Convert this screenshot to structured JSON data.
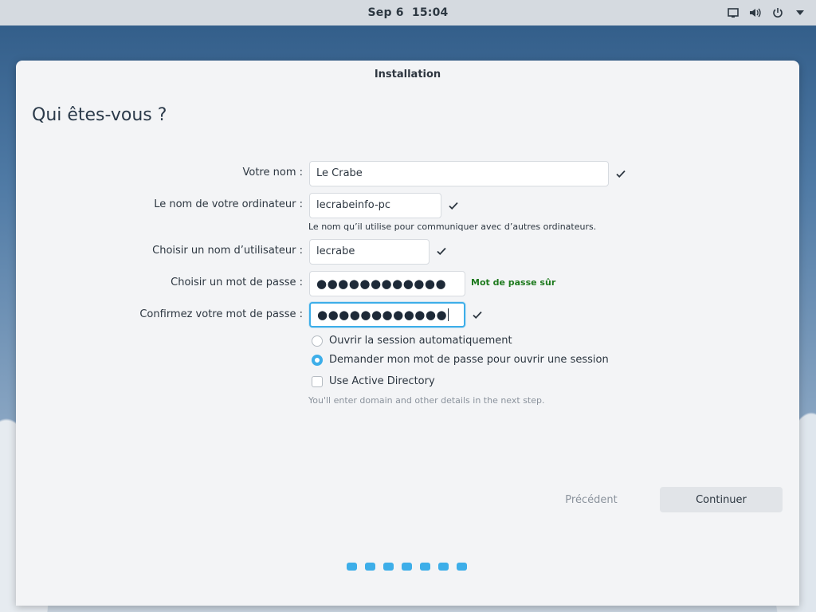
{
  "topbar": {
    "date": "Sep 6",
    "time": "15:04",
    "icons": [
      "display-icon",
      "volume-icon",
      "power-icon",
      "menu-arrow-icon"
    ]
  },
  "window": {
    "title": "Installation",
    "heading": "Qui êtes-vous ?"
  },
  "form": {
    "name": {
      "label": "Votre nom :",
      "value": "Le Crabe"
    },
    "computer": {
      "label": "Le nom de votre ordinateur :",
      "value": "lecrabeinfo-pc",
      "hint": "Le nom qu’il utilise pour communiquer avec d’autres ordinateurs."
    },
    "username": {
      "label": "Choisir un nom d’utilisateur :",
      "value": "lecrabe"
    },
    "password": {
      "label": "Choisir un mot de passe :",
      "value": "●●●●●●●●●●●●",
      "strength": "Mot de passe sûr"
    },
    "confirm": {
      "label": "Confirmez votre mot de passe :",
      "value": "●●●●●●●●●●●●"
    }
  },
  "options": {
    "auto_login": {
      "label": "Ouvrir la session automatiquement",
      "checked": false
    },
    "ask_password": {
      "label": "Demander mon mot de passe pour ouvrir une session",
      "checked": true
    },
    "active_directory": {
      "label": "Use Active Directory",
      "checked": false
    },
    "ad_hint": "You'll enter domain and other details in the next step."
  },
  "nav": {
    "back": "Précédent",
    "next": "Continuer"
  },
  "colors": {
    "accent": "#3daee9",
    "strength_ok": "#1e7a1e"
  }
}
